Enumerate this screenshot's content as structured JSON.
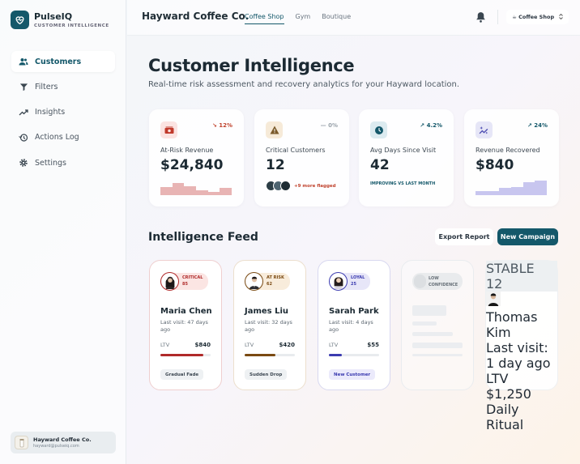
{
  "brand": {
    "name": "PulseIQ",
    "subtitle": "CUSTOMER INTELLIGENCE"
  },
  "sidebar": {
    "items": [
      {
        "label": "Customers",
        "icon": "users-icon",
        "active": true
      },
      {
        "label": "Filters",
        "icon": "filter-icon",
        "active": false
      },
      {
        "label": "Insights",
        "icon": "trend-line-icon",
        "active": false
      },
      {
        "label": "Actions Log",
        "icon": "history-icon",
        "active": false
      },
      {
        "label": "Settings",
        "icon": "gear-icon",
        "active": false
      }
    ],
    "user": {
      "name": "Hayward Coffee Co.",
      "email": "hayward@pulseiq.com"
    }
  },
  "topbar": {
    "company": "Hayward Coffee Co.",
    "tabs": [
      "Coffee Shop",
      "Gym",
      "Boutique"
    ],
    "active_tab": "Coffee Shop",
    "location_select": "☕ Coffee Shop"
  },
  "page": {
    "title": "Customer Intelligence",
    "subtitle": "Real-time risk assessment and recovery analytics for your Hayward location."
  },
  "stats": [
    {
      "label": "At-Risk Revenue",
      "value": "$24,840",
      "trend": "↘ 12%",
      "trend_color": "#c0432e",
      "icon": "money-icon",
      "icon_bg": "#fbe3e1",
      "icon_color": "#c0392b",
      "bar_color": "#e8b4b4",
      "bars": [
        0.55,
        0.85,
        0.6,
        0.35,
        0.25,
        0.5
      ]
    },
    {
      "label": "Critical Customers",
      "value": "12",
      "trend": "— 0%",
      "trend_color": "#9aa3ab",
      "icon": "warning-icon",
      "icon_bg": "#f6ead8",
      "icon_color": "#7a5a2a",
      "more": "+9 more flagged"
    },
    {
      "label": "Avg Days Since Visit",
      "value": "42",
      "trend": "↗ 4.2%",
      "trend_color": "#14586a",
      "icon": "clock-icon",
      "icon_bg": "#dcebf0",
      "icon_color": "#14586a",
      "note": "IMPROVING VS LAST MONTH"
    },
    {
      "label": "Revenue Recovered",
      "value": "$840",
      "trend": "↗ 24%",
      "trend_color": "#14586a",
      "icon": "sparkle-icon",
      "icon_bg": "#e6e6f7",
      "icon_color": "#4a4ab0",
      "bar_color": "#c8c6ef",
      "bars": [
        0.3,
        0.3,
        0.5,
        0.55,
        0.9,
        1.0
      ]
    }
  ],
  "feed": {
    "title": "Intelligence Feed",
    "export_label": "Export Report",
    "campaign_label": "New Campaign",
    "cards": [
      {
        "name": "Maria Chen",
        "status": "CRITICAL",
        "score": "85",
        "visit": "Last visit: 47 days ago",
        "ltv_label": "LTV",
        "ltv": "$840",
        "progress": 0.85,
        "tag": "Gradual Fade",
        "color": "#b02a2a",
        "badge_bg": "#fbe5e3",
        "badge_fg": "#b02a2a",
        "border": "#efcfcf",
        "tag_bg": "#eef1f3",
        "tag_fg": "#3e4953"
      },
      {
        "name": "James Liu",
        "status": "AT RISK",
        "score": "62",
        "visit": "Last visit: 32 days ago",
        "ltv_label": "LTV",
        "ltv": "$420",
        "progress": 0.62,
        "tag": "Sudden Drop",
        "color": "#7a4a12",
        "badge_bg": "#f8ecdb",
        "badge_fg": "#7a4a12",
        "border": "#ecdfcd",
        "tag_bg": "#eef1f3",
        "tag_fg": "#3e4953"
      },
      {
        "name": "Sarah Park",
        "status": "LOYAL",
        "score": "25",
        "visit": "Last visit: 4 days ago",
        "ltv_label": "LTV",
        "ltv": "$55",
        "progress": 0.25,
        "tag": "New Customer",
        "color": "#3b3bb0",
        "badge_bg": "#e7e6f8",
        "badge_fg": "#3b3bb0",
        "border": "#d8d8f0",
        "tag_bg": "#ebeafb",
        "tag_fg": "#3b3bb0"
      }
    ],
    "ghost": {
      "label": "LOW CONFIDENCE"
    },
    "stable": {
      "name": "Thomas Kim",
      "status": "STABLE",
      "score": "12",
      "visit": "Last visit: 1 day ago",
      "ltv_label": "LTV",
      "ltv": "$1,250",
      "progress": 0.12,
      "tag": "Daily Ritual",
      "color": "#14586a"
    }
  }
}
